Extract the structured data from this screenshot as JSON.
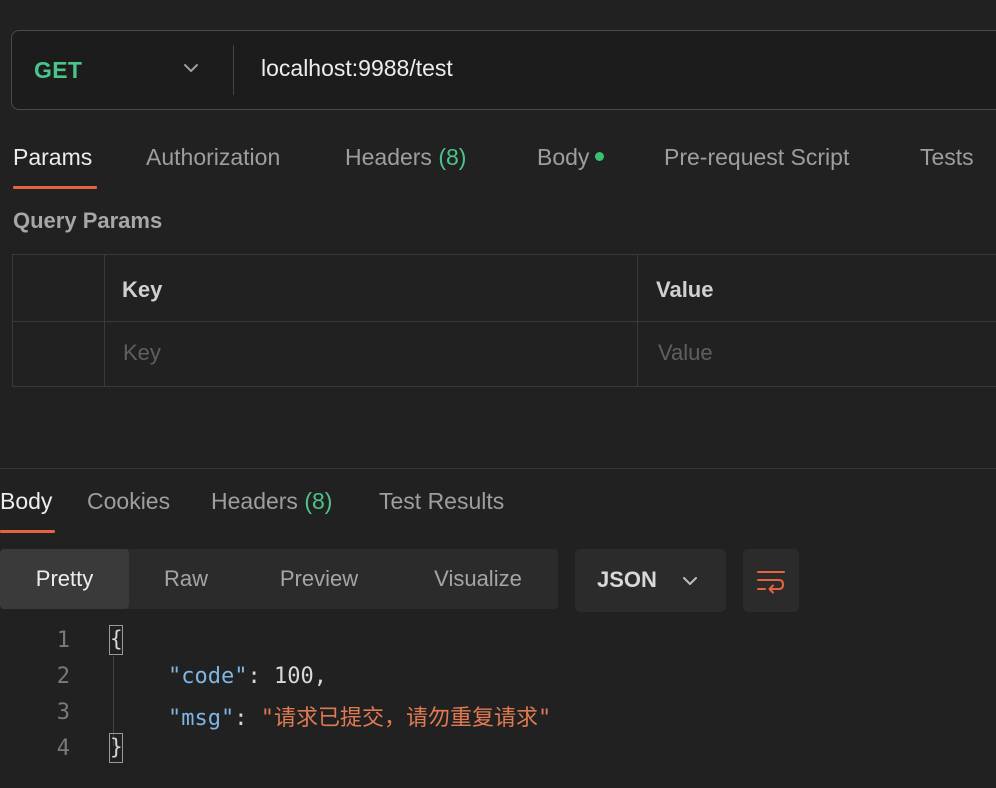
{
  "request": {
    "method": "GET",
    "url": "localhost:9988/test"
  },
  "request_tabs": [
    {
      "label": "Params",
      "active": true
    },
    {
      "label": "Authorization"
    },
    {
      "label": "Headers",
      "count": "(8)"
    },
    {
      "label": "Body",
      "indicator": "green-dot-icon"
    },
    {
      "label": "Pre-request Script"
    },
    {
      "label": "Tests"
    }
  ],
  "query_params": {
    "title": "Query Params",
    "columns": {
      "key": "Key",
      "value": "Value"
    },
    "placeholders": {
      "key": "Key",
      "value": "Value"
    }
  },
  "response_tabs": [
    {
      "label": "Body",
      "active": true
    },
    {
      "label": "Cookies"
    },
    {
      "label": "Headers",
      "count": "(8)"
    },
    {
      "label": "Test Results"
    }
  ],
  "format_buttons": [
    {
      "label": "Pretty",
      "active": true
    },
    {
      "label": "Raw"
    },
    {
      "label": "Preview"
    },
    {
      "label": "Visualize"
    }
  ],
  "format_select": {
    "value": "JSON",
    "icon": "chevron-down-icon"
  },
  "wrap_button": {
    "icon": "wrap-lines-icon"
  },
  "response_body": {
    "line_numbers": [
      "1",
      "2",
      "3",
      "4"
    ],
    "open_brace": "{",
    "close_brace": "}",
    "code_key": "\"code\"",
    "code_value": "100",
    "msg_key": "\"msg\"",
    "msg_value": "\"请求已提交，请勿重复请求\"",
    "colon": ": ",
    "comma": ","
  },
  "colors": {
    "accent_orange": "#e3643f",
    "method_green": "#4cc38a",
    "json_key_blue": "#7fb4e6",
    "json_string_orange": "#e07a52",
    "background": "#212121"
  }
}
